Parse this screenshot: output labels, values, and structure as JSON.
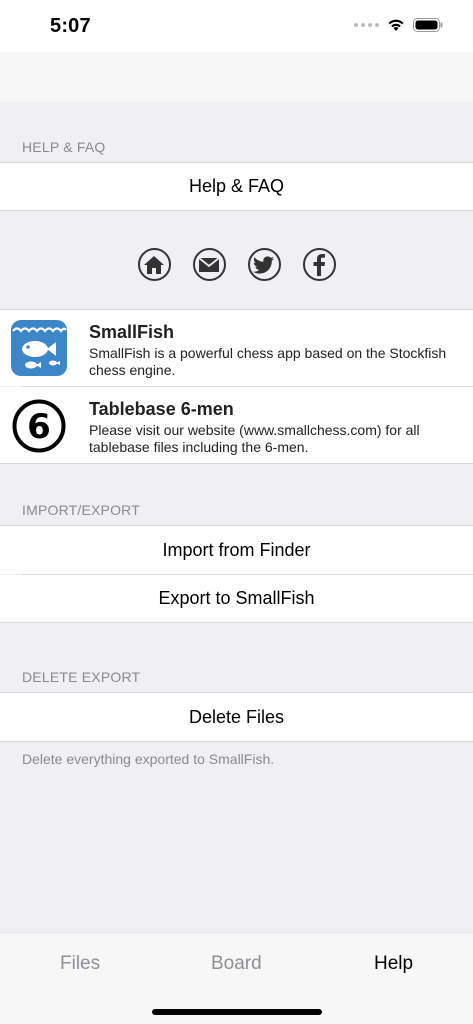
{
  "status": {
    "time": "5:07"
  },
  "help_section": {
    "header": "HELP & FAQ",
    "button": "Help & FAQ"
  },
  "social": {
    "icons": [
      "home-icon",
      "mail-icon",
      "twitter-icon",
      "facebook-icon"
    ]
  },
  "apps": [
    {
      "title": "SmallFish",
      "description": "SmallFish is a powerful chess app based on the Stockfish chess engine.",
      "icon": "fish-icon"
    },
    {
      "title": "Tablebase 6-men",
      "description": "Please visit our website (www.smallchess.com) for all tablebase files including the 6-men.",
      "icon": "number-six-icon",
      "icon_glyph": "6"
    }
  ],
  "import_export": {
    "header": "IMPORT/EXPORT",
    "import_label": "Import from Finder",
    "export_label": "Export to SmallFish"
  },
  "delete_export": {
    "header": "DELETE EXPORT",
    "button": "Delete Files",
    "note": "Delete everything exported to SmallFish."
  },
  "tabs": [
    {
      "label": "Files",
      "active": false
    },
    {
      "label": "Board",
      "active": false
    },
    {
      "label": "Help",
      "active": true
    }
  ],
  "colors": {
    "accent": "#3d87c9",
    "background": "#efeff4",
    "inactive_tab": "#8e8e93"
  }
}
